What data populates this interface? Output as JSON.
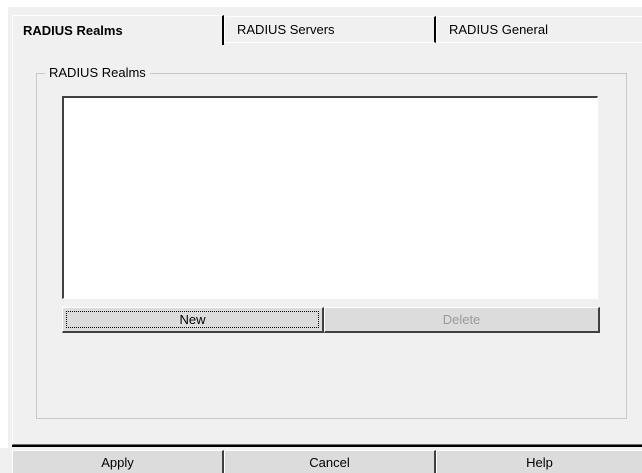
{
  "tabs": [
    {
      "label": "RADIUS Realms",
      "active": true
    },
    {
      "label": "RADIUS Servers",
      "active": false
    },
    {
      "label": "RADIUS General",
      "active": false
    }
  ],
  "group": {
    "legend": "RADIUS Realms",
    "list_items": []
  },
  "buttons": {
    "new": "New",
    "delete": "Delete"
  },
  "footer": {
    "apply": "Apply",
    "cancel": "Cancel",
    "help": "Help"
  },
  "colors": {
    "background": "#f0f0f0",
    "list_background": "#ffffff",
    "disabled_text": "#9a9a9a"
  }
}
